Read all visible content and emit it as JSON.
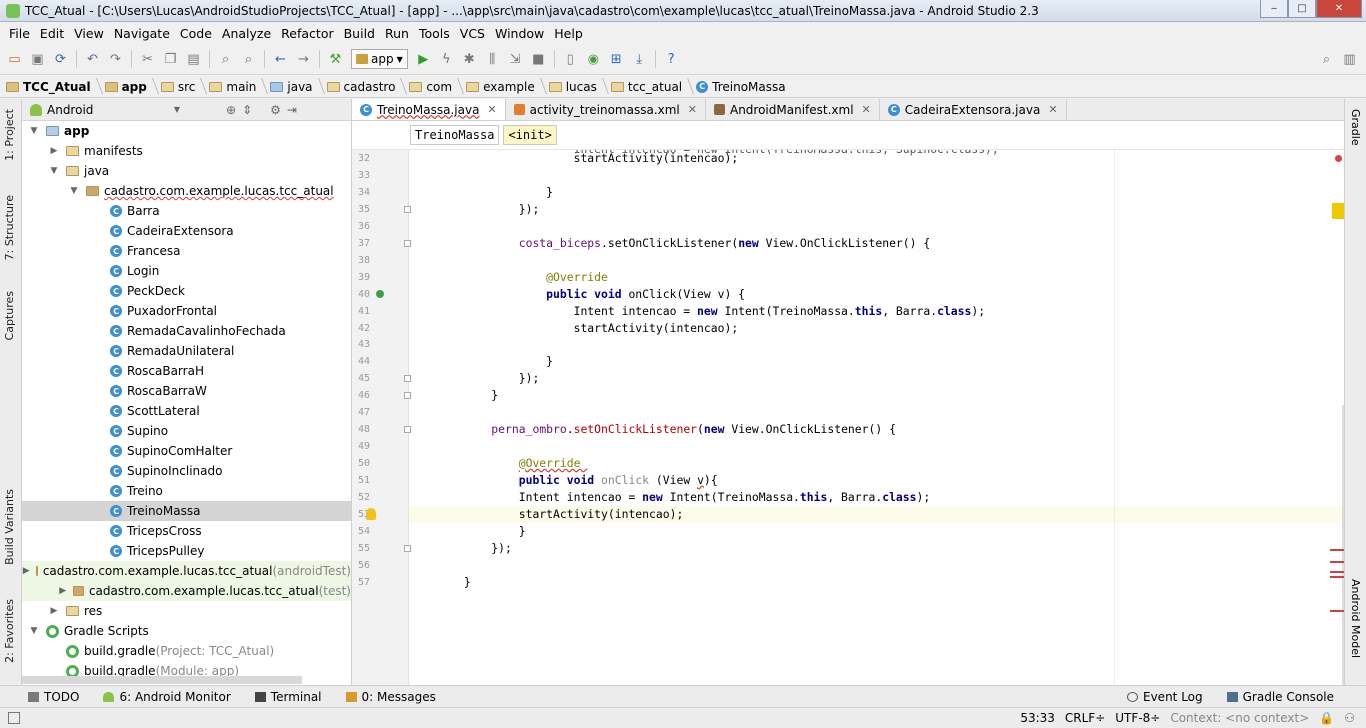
{
  "window": {
    "title": "TCC_Atual - [C:\\Users\\Lucas\\AndroidStudioProjects\\TCC_Atual] - [app] - ...\\app\\src\\main\\java\\cadastro\\com\\example\\lucas\\tcc_atual\\TreinoMassa.java - Android Studio 2.3",
    "minimize": "‒",
    "maximize": "□",
    "close": "✕"
  },
  "menu": [
    "File",
    "Edit",
    "View",
    "Navigate",
    "Code",
    "Analyze",
    "Refactor",
    "Build",
    "Run",
    "Tools",
    "VCS",
    "Window",
    "Help"
  ],
  "toolbar": {
    "run_config": "app"
  },
  "breadcrumbs": [
    "TCC_Atual",
    "app",
    "src",
    "main",
    "java",
    "cadastro",
    "com",
    "example",
    "lucas",
    "tcc_atual",
    "TreinoMassa"
  ],
  "left_tabs": {
    "project": "1: Project",
    "structure": "7: Structure",
    "captures": "Captures",
    "build_variants": "Build Variants",
    "favorites": "2: Favorites"
  },
  "right_tabs": {
    "gradle": "Gradle",
    "android_model": "Android Model"
  },
  "project_panel": {
    "view": "Android",
    "tree": [
      {
        "label": "app",
        "indent": 0,
        "arrow": "▼",
        "icon": "module"
      },
      {
        "label": "manifests",
        "indent": 1,
        "arrow": "▶",
        "icon": "folder"
      },
      {
        "label": "java",
        "indent": 1,
        "arrow": "▼",
        "icon": "folder"
      },
      {
        "label": "cadastro.com.example.lucas.tcc_atual",
        "indent": 2,
        "arrow": "▼",
        "icon": "package",
        "wavy": true
      },
      {
        "label": "Barra",
        "indent": 3,
        "icon": "class"
      },
      {
        "label": "CadeiraExtensora",
        "indent": 3,
        "icon": "class"
      },
      {
        "label": "Francesa",
        "indent": 3,
        "icon": "class"
      },
      {
        "label": "Login",
        "indent": 3,
        "icon": "class"
      },
      {
        "label": "PeckDeck",
        "indent": 3,
        "icon": "class"
      },
      {
        "label": "PuxadorFrontal",
        "indent": 3,
        "icon": "class"
      },
      {
        "label": "RemadaCavalinhoFechada",
        "indent": 3,
        "icon": "class"
      },
      {
        "label": "RemadaUnilateral",
        "indent": 3,
        "icon": "class"
      },
      {
        "label": "RoscaBarraH",
        "indent": 3,
        "icon": "class"
      },
      {
        "label": "RoscaBarraW",
        "indent": 3,
        "icon": "class"
      },
      {
        "label": "ScottLateral",
        "indent": 3,
        "icon": "class"
      },
      {
        "label": "Supino",
        "indent": 3,
        "icon": "class"
      },
      {
        "label": "SupinoComHalter",
        "indent": 3,
        "icon": "class"
      },
      {
        "label": "SupinoInclinado",
        "indent": 3,
        "icon": "class"
      },
      {
        "label": "Treino",
        "indent": 3,
        "icon": "class"
      },
      {
        "label": "TreinoMassa",
        "indent": 3,
        "icon": "class",
        "selected": true
      },
      {
        "label": "TricepsCross",
        "indent": 3,
        "icon": "class"
      },
      {
        "label": "TricepsPulley",
        "indent": 3,
        "icon": "class"
      },
      {
        "label": "cadastro.com.example.lucas.tcc_atual",
        "suffix": " (androidTest)",
        "indent": 2,
        "arrow": "▶",
        "icon": "package",
        "green": true
      },
      {
        "label": "cadastro.com.example.lucas.tcc_atual",
        "suffix": " (test)",
        "indent": 2,
        "arrow": "▶",
        "icon": "package",
        "green": true
      },
      {
        "label": "res",
        "indent": 1,
        "arrow": "▶",
        "icon": "folder"
      },
      {
        "label": "Gradle Scripts",
        "indent": 0,
        "arrow": "▼",
        "icon": "gradle"
      },
      {
        "label": "build.gradle",
        "suffix": " (Project: TCC_Atual)",
        "indent": 1,
        "icon": "gradle"
      },
      {
        "label": "build.gradle",
        "suffix": " (Module: app)",
        "indent": 1,
        "icon": "gradle"
      }
    ]
  },
  "editor_tabs": [
    {
      "label": "TreinoMassa.java",
      "icon": "class",
      "active": true
    },
    {
      "label": "activity_treinomassa.xml",
      "icon": "xml"
    },
    {
      "label": "AndroidManifest.xml",
      "icon": "xml"
    },
    {
      "label": "CadeiraExtensora.java",
      "icon": "class"
    }
  ],
  "editor_breadcrumb": [
    "TreinoMassa",
    "<init>"
  ],
  "code_lines": [
    {
      "n": 32,
      "html": "                        startActivity(intencao);"
    },
    {
      "n": 33,
      "html": ""
    },
    {
      "n": 34,
      "html": "                    }"
    },
    {
      "n": 35,
      "html": "                });"
    },
    {
      "n": 36,
      "html": ""
    },
    {
      "n": 37,
      "html": "                <span class=\"fld\">costa_biceps</span>.setOnClickListener(<span class=\"kw\">new</span> View.OnClickListener() {"
    },
    {
      "n": 38,
      "html": ""
    },
    {
      "n": 39,
      "html": "                    <span class=\"ann\">@Override</span>"
    },
    {
      "n": 40,
      "html": "                    <span class=\"kw\">public void</span> onClick(View v) {"
    },
    {
      "n": 41,
      "html": "                        Intent intencao = <span class=\"kw\">new</span> Intent(TreinoMassa.<span class=\"kw\">this</span>, Barra.<span class=\"kw\">class</span>);"
    },
    {
      "n": 42,
      "html": "                        startActivity(intencao);"
    },
    {
      "n": 43,
      "html": ""
    },
    {
      "n": 44,
      "html": "                    }"
    },
    {
      "n": 45,
      "html": "                });"
    },
    {
      "n": 46,
      "html": "            }"
    },
    {
      "n": 47,
      "html": ""
    },
    {
      "n": 48,
      "html": "            <span class=\"fld\">perna_ombro</span>.<span style=\"color:#b00000\">setOnClickListener</span>(<span class=\"kw\">new</span> View.OnClickListener() {"
    },
    {
      "n": 49,
      "html": ""
    },
    {
      "n": 50,
      "html": "                <span class=\"ann\" style=\"text-decoration:underline wavy #d43c3c\">@Override </span>"
    },
    {
      "n": 51,
      "html": "                <span class=\"kw\">public void</span> <span class=\"gray\">onClick</span> (View <span style=\"text-decoration:underline wavy #d43c3c\">v</span>){"
    },
    {
      "n": 52,
      "html": "                Intent intencao = <span class=\"kw\">new</span> Intent(TreinoMassa.<span class=\"kw\">this</span>, Barra.<span class=\"kw\">class</span>);"
    },
    {
      "n": 53,
      "html": "                startActivity(intencao);",
      "current": true
    },
    {
      "n": 54,
      "html": "                }"
    },
    {
      "n": 55,
      "html": "            });"
    },
    {
      "n": 56,
      "html": ""
    },
    {
      "n": 57,
      "html": "        }"
    }
  ],
  "bottom_tools": [
    {
      "label": "TODO",
      "color": "#555555"
    },
    {
      "label": "6: Android Monitor",
      "color": "#8bc34a"
    },
    {
      "label": "Terminal",
      "color": "#333333"
    },
    {
      "label": "0: Messages",
      "color": "#d89a2c"
    }
  ],
  "bottom_right_tools": [
    {
      "label": "Event Log"
    },
    {
      "label": "Gradle Console"
    }
  ],
  "status": {
    "position": "53:33",
    "line_sep": "CRLF÷",
    "encoding": "UTF-8÷",
    "context": "Context: <no context>"
  }
}
